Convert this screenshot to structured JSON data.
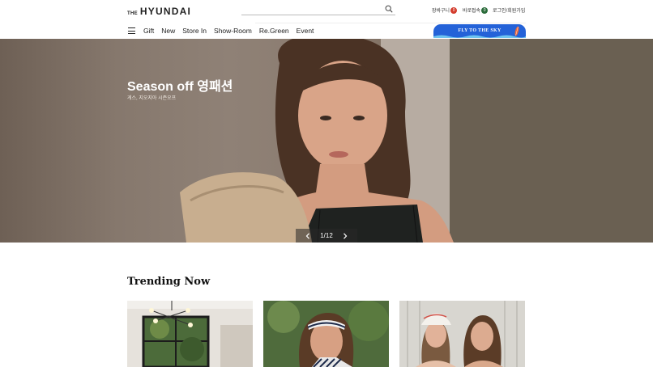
{
  "header": {
    "logo_prefix": "THE",
    "logo_main": "HYUNDAI",
    "search": {
      "placeholder": "",
      "icon": "search-icon"
    },
    "utilities": [
      {
        "label": "장바구니",
        "badge": "0",
        "badge_color": "#d33b2c"
      },
      {
        "label": "바로접속",
        "badge": "0",
        "badge_color": "#2a6b3a"
      },
      {
        "label": "로그인/회원가입"
      }
    ]
  },
  "nav": {
    "menu_icon": "hamburger-menu-icon",
    "items": [
      "Gift",
      "New",
      "Store In",
      "Show-Room",
      "Re.Green",
      "Event"
    ]
  },
  "promo": {
    "text": "FLY TO THE SKY",
    "color": "#2462d8"
  },
  "hero": {
    "title": "Season off 영패션",
    "subtitle": "게스, 지오지아 시즌오프",
    "pager": {
      "current": 1,
      "total": 12,
      "label": "1/12"
    }
  },
  "trending": {
    "title": "Trending Now",
    "cards": [
      {
        "image": "interior-with-chandelier-and-window"
      },
      {
        "image": "woman-with-headband-outdoors"
      },
      {
        "image": "two-women-in-cap"
      }
    ]
  }
}
